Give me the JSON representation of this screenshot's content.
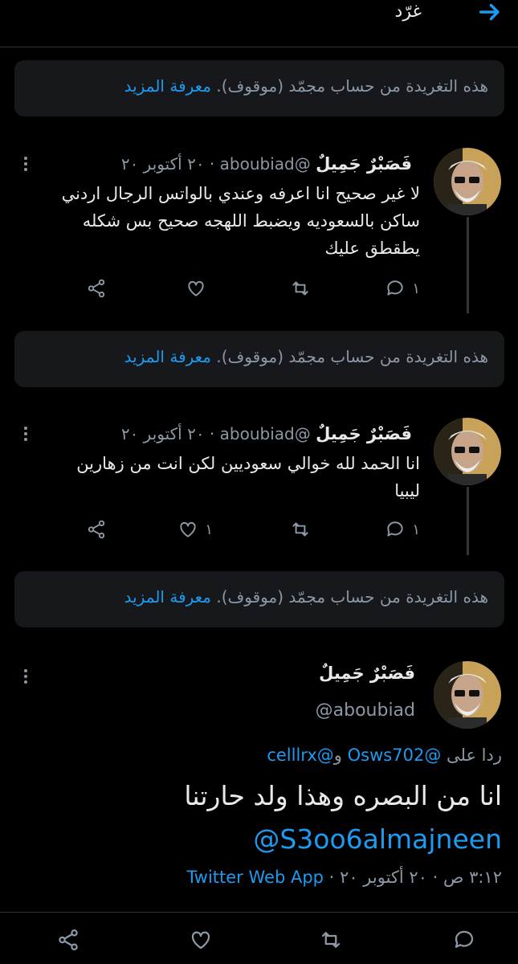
{
  "header": {
    "title": "غرّد",
    "back_icon": "arrow-right-icon"
  },
  "notice": {
    "text": "هذه التغريدة من حساب مجمّد (موقوف).",
    "link": "معرفة المزيد"
  },
  "replies": [
    {
      "name": "فَصَبْرٌ جَمِيلٌ",
      "handle": "@aboubiad",
      "date": "٢٠ أكتوبر ٢٠",
      "lines": [
        "لا غير صحيح انا اعرفه وعندي بالواتس الرجال اردني",
        "ساكن بالسعوديه ويضبط اللهجه صحيح بس شكله",
        "يطقطق عليك"
      ],
      "reply_count": "١",
      "retweet_count": "",
      "like_count": ""
    },
    {
      "name": "فَصَبْرٌ جَمِيلٌ",
      "handle": "@aboubiad",
      "date": "٢٠ أكتوبر ٢٠",
      "lines": [
        "انا الحمد لله خوالي سعوديين لكن انت من زهارين",
        "ليبيا"
      ],
      "reply_count": "١",
      "retweet_count": "",
      "like_count": "١"
    }
  ],
  "main_tweet": {
    "name": "فَصَبْرٌ جَمِيلٌ",
    "handle": "@aboubiad",
    "replying_prefix": "ردا على",
    "replying_user1": "@Osws702",
    "replying_and": "و",
    "replying_user2": "@celllrx",
    "text": "انا من البصره وهذا ولد حارتنا",
    "mention": "@S3oo6almajneen",
    "timestamp": "٣:١٢ ص · ٢٠ أكتوبر ٢٠",
    "source": "Twitter Web App"
  }
}
